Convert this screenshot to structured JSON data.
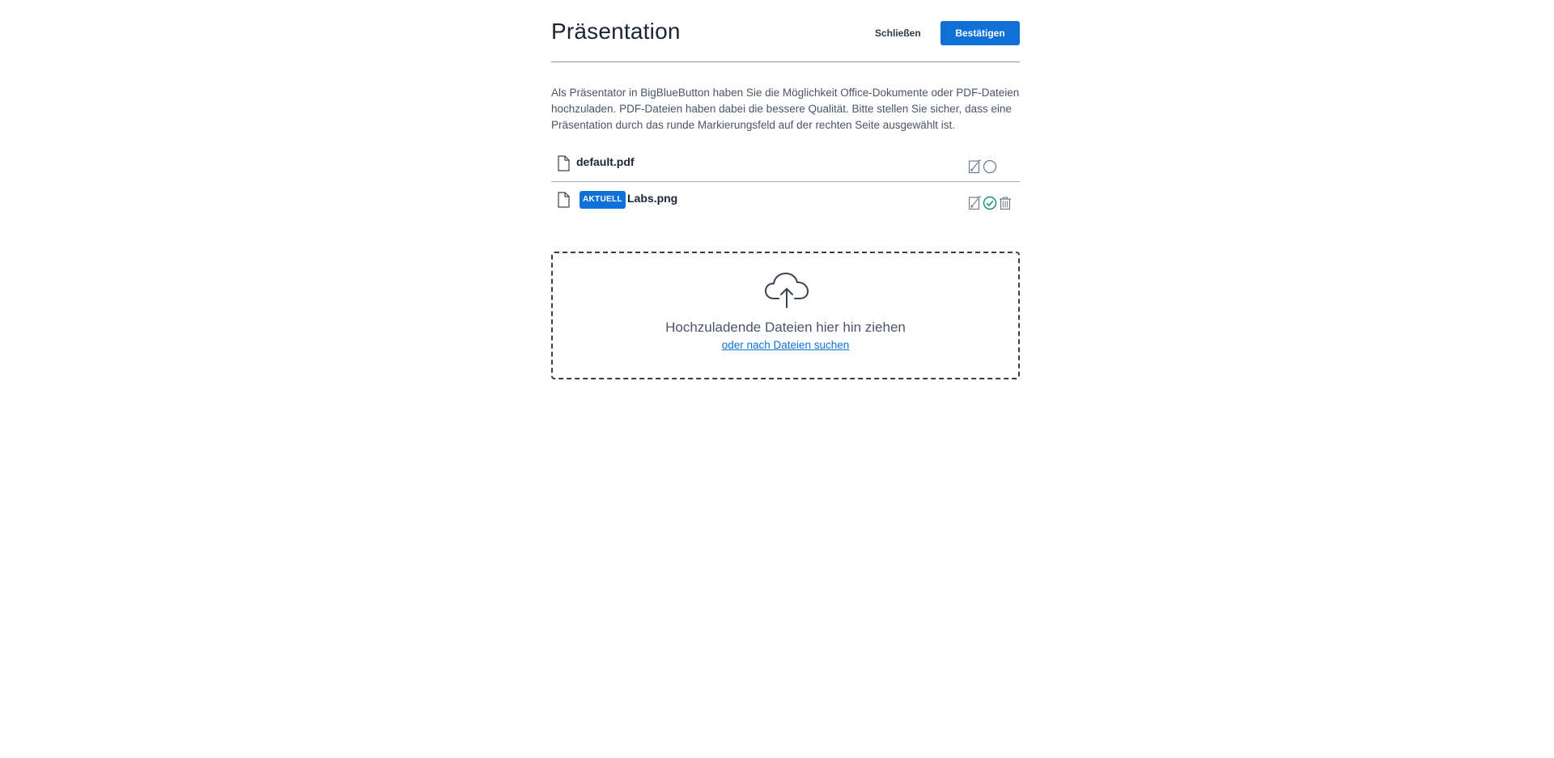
{
  "header": {
    "title": "Präsentation",
    "close_label": "Schließen",
    "confirm_label": "Bestätigen"
  },
  "description": "Als Präsentator in BigBlueButton haben Sie die Möglichkeit Office-Dokumente oder PDF-Dateien hochzuladen. PDF-Dateien haben dabei die bessere Qualität. Bitte stellen Sie sicher, dass eine Präsentation durch das runde Markierungsfeld auf der rechten Seite ausgewählt ist.",
  "files": [
    {
      "name": "default.pdf",
      "current": false,
      "icon": "file-icon",
      "actions": [
        "download-toggle-icon",
        "radio-unselected-icon"
      ]
    },
    {
      "name": "Labs.png",
      "current": true,
      "badge": "AKTUELL",
      "icon": "file-icon",
      "actions": [
        "download-toggle-icon",
        "radio-selected-check-icon",
        "trash-icon"
      ]
    }
  ],
  "dropzone": {
    "icon": "cloud-upload-icon",
    "text": "Hochzuladende Dateien hier hin ziehen",
    "link": "oder nach Dateien suchen"
  },
  "colors": {
    "accent": "#0f70d7",
    "success": "#0c8f6a",
    "text": "#1a2433"
  }
}
